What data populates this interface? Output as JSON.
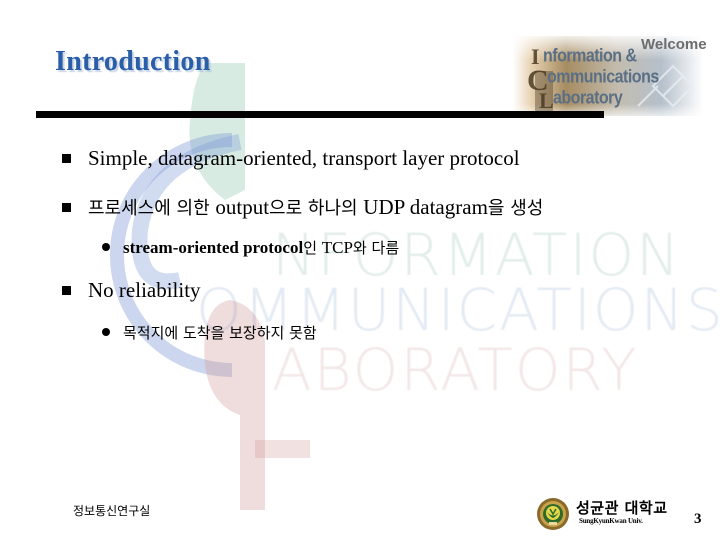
{
  "slide": {
    "title": "Introduction",
    "banner": {
      "welcome": "Welcome",
      "lines": [
        "nformation &",
        "ommunications",
        "aboratory"
      ],
      "initials": [
        "I",
        "C",
        "L"
      ]
    },
    "watermark": {
      "lines": [
        "NFORMATION",
        "OMMUNICATIONS",
        "ABORATORY"
      ]
    },
    "bullets": [
      {
        "level": 1,
        "segments": [
          {
            "text": "Simple, datagram-oriented, transport layer protocol",
            "script": "latin"
          }
        ]
      },
      {
        "level": 1,
        "segments": [
          {
            "text": "프로세스에 의한 ",
            "script": "korean"
          },
          {
            "text": "output",
            "script": "latin"
          },
          {
            "text": "으로 하나의 ",
            "script": "korean"
          },
          {
            "text": "UDP datagram",
            "script": "latin"
          },
          {
            "text": "을 생성",
            "script": "korean"
          }
        ]
      },
      {
        "level": 2,
        "segments": [
          {
            "text": "stream-oriented protocol",
            "script": "latin"
          },
          {
            "text": "인 ",
            "script": "korean"
          },
          {
            "text": "TCP",
            "script": "latin"
          },
          {
            "text": "와 다름",
            "script": "korean"
          }
        ]
      },
      {
        "level": 1,
        "segments": [
          {
            "text": "No reliability",
            "script": "latin"
          }
        ]
      },
      {
        "level": 2,
        "segments": [
          {
            "text": "목적지에 도착을 보장하지 못함",
            "script": "korean"
          }
        ]
      }
    ],
    "footer": {
      "lab_name": "정보통신연구실",
      "university_name": "성균관 대학교",
      "university_sub": "SungKyunKwan Univ.",
      "page_number": "3"
    },
    "colors": {
      "title": "#2b5ea8",
      "rule": "#000000",
      "watermark_green": "#7fb8a0",
      "watermark_blue": "#6f8fd0",
      "watermark_red": "#c98a8a"
    }
  }
}
